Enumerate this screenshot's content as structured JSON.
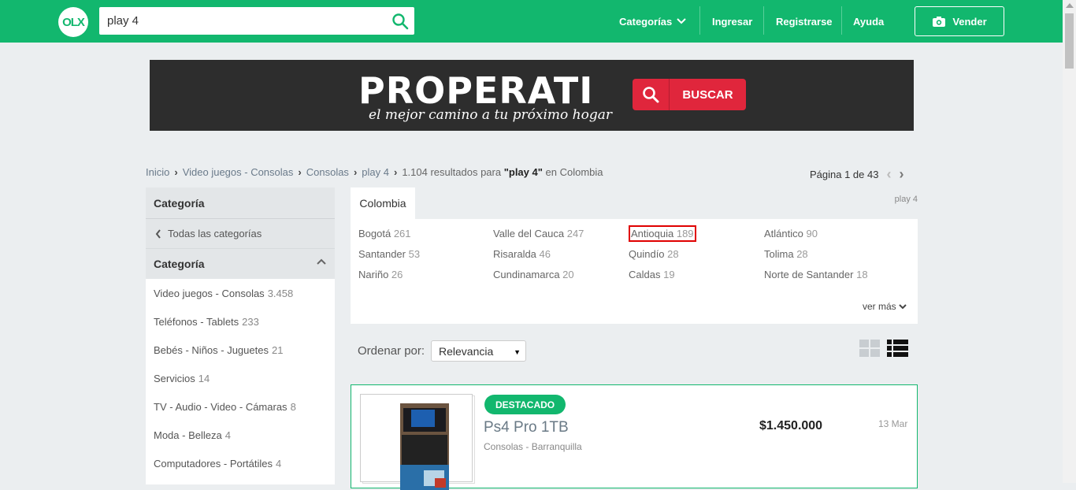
{
  "header": {
    "logo_text": "OLX",
    "search_value": "play 4",
    "nav": {
      "categorias": "Categorías",
      "ingresar": "Ingresar",
      "registrarse": "Registrarse",
      "ayuda": "Ayuda",
      "vender": "Vender"
    },
    "brand_color": "#12b76e"
  },
  "banner": {
    "title": "PROPERATI",
    "subtitle": "el mejor camino a tu próximo hogar",
    "button": "BUSCAR"
  },
  "breadcrumb": {
    "items": [
      "Inicio",
      "Video juegos - Consolas",
      "Consolas",
      "play 4"
    ],
    "results_count": "1.104 resultados para",
    "results_query": "\"play 4\"",
    "results_location": "en Colombia"
  },
  "pager": {
    "label": "Página 1 de 43"
  },
  "sidebar": {
    "heading": "Categoría",
    "all_link": "Todas las categorías",
    "subheading": "Categoría",
    "items": [
      {
        "label": "Video juegos - Consolas",
        "count": "3.458"
      },
      {
        "label": "Teléfonos - Tablets",
        "count": "233"
      },
      {
        "label": "Bebés - Niños - Juguetes",
        "count": "21"
      },
      {
        "label": "Servicios",
        "count": "14"
      },
      {
        "label": "TV - Audio - Video - Cámaras",
        "count": "8"
      },
      {
        "label": "Moda - Belleza",
        "count": "4"
      },
      {
        "label": "Computadores - Portátiles",
        "count": "4"
      }
    ]
  },
  "locations": {
    "tab": "Colombia",
    "query_tag": "play 4",
    "items": [
      {
        "name": "Bogotá",
        "count": "261"
      },
      {
        "name": "Valle del Cauca",
        "count": "247"
      },
      {
        "name": "Antioquia",
        "count": "189"
      },
      {
        "name": "Atlántico",
        "count": "90"
      },
      {
        "name": "Santander",
        "count": "53"
      },
      {
        "name": "Risaralda",
        "count": "46"
      },
      {
        "name": "Quindío",
        "count": "28"
      },
      {
        "name": "Tolima",
        "count": "28"
      },
      {
        "name": "Nariño",
        "count": "26"
      },
      {
        "name": "Cundinamarca",
        "count": "20"
      },
      {
        "name": "Caldas",
        "count": "19"
      },
      {
        "name": "Norte de Santander",
        "count": "18"
      }
    ],
    "more": "ver más"
  },
  "sort": {
    "label": "Ordenar por:",
    "selected": "Relevancia"
  },
  "listing": {
    "badge": "DESTACADO",
    "title": "Ps4 Pro 1TB",
    "subtitle": "Consolas - Barranquilla",
    "price": "$1.450.000",
    "date": "13 Mar"
  }
}
